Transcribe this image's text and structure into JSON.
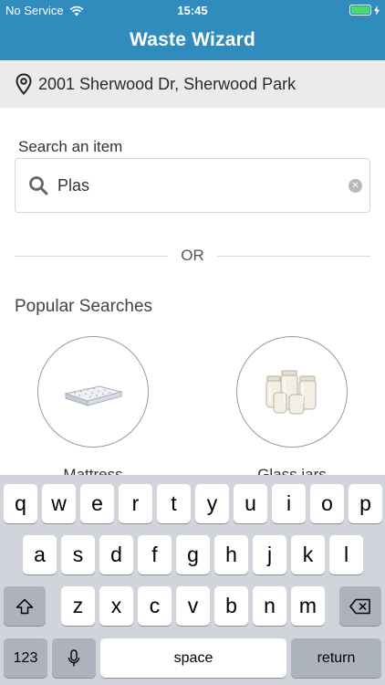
{
  "status_bar": {
    "carrier": "No Service",
    "time": "15:45"
  },
  "app": {
    "title": "Waste Wizard"
  },
  "address": {
    "text": "2001 Sherwood Dr, Sherwood Park"
  },
  "search": {
    "label": "Search an item",
    "value": "Plas"
  },
  "divider": {
    "text": "OR"
  },
  "popular": {
    "title": "Popular Searches",
    "items": [
      {
        "label": "Mattress"
      },
      {
        "label": "Glass jars"
      }
    ]
  },
  "keyboard": {
    "row1": [
      "q",
      "w",
      "e",
      "r",
      "t",
      "y",
      "u",
      "i",
      "o",
      "p"
    ],
    "row2": [
      "a",
      "s",
      "d",
      "f",
      "g",
      "h",
      "j",
      "k",
      "l"
    ],
    "row3": [
      "z",
      "x",
      "c",
      "v",
      "b",
      "n",
      "m"
    ],
    "numbers_label": "123",
    "space_label": "space",
    "return_label": "return"
  },
  "colors": {
    "header": "#2f8cbd",
    "address_bg": "#ebebeb",
    "battery": "#4cd964"
  }
}
